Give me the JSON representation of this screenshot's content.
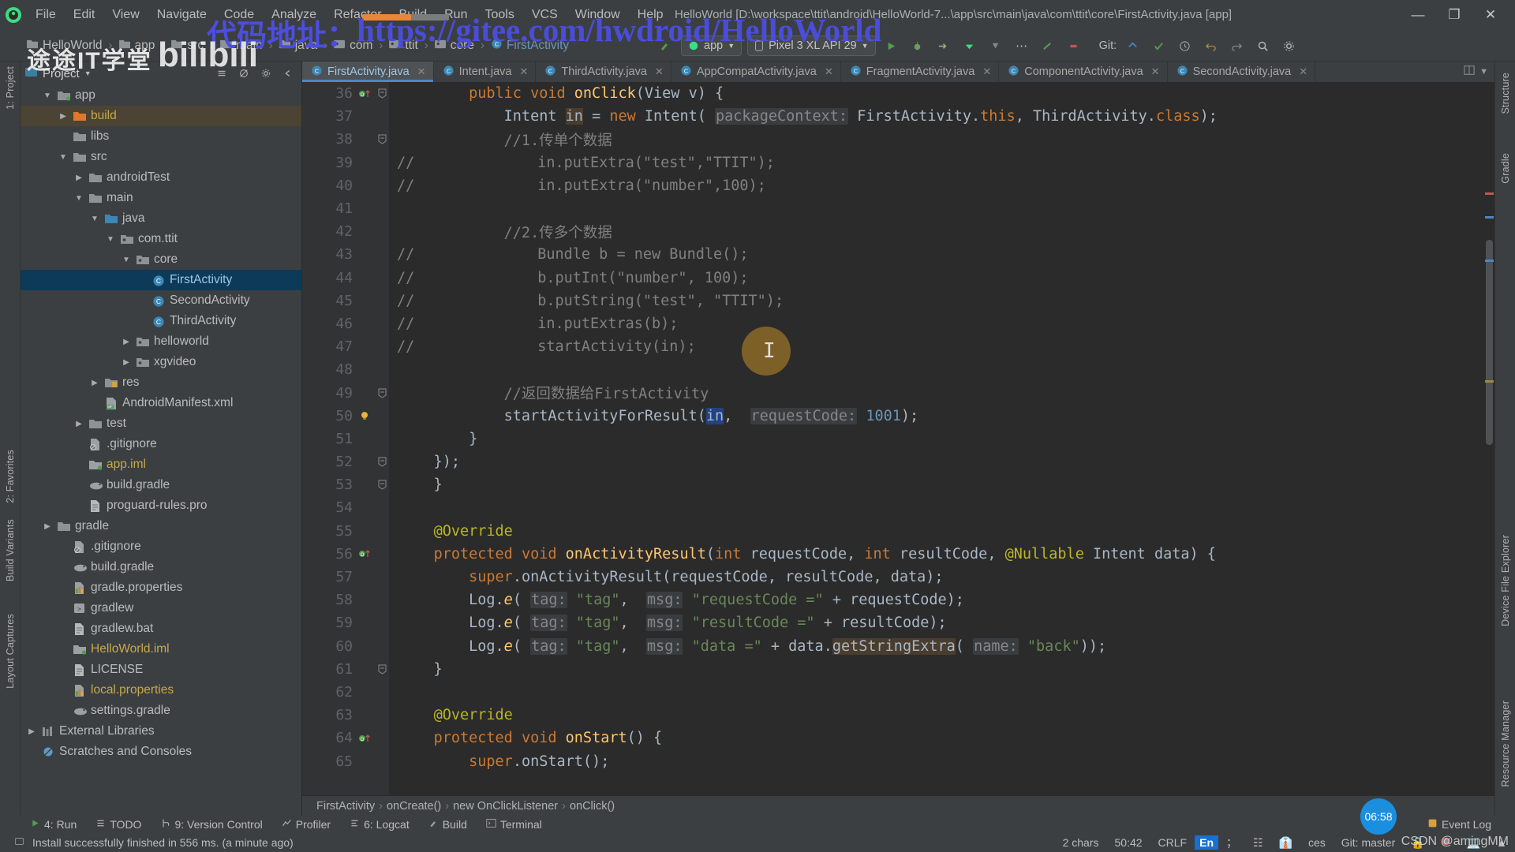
{
  "window": {
    "title": "HelloWorld [D:\\workspace\\ttit\\android\\HelloWorld-7...\\app\\src\\main\\java\\com\\ttit\\core\\FirstActivity.java [app]",
    "minimize": "—",
    "maximize": "❐",
    "close": "✕"
  },
  "menu": [
    {
      "label": "File"
    },
    {
      "label": "Edit"
    },
    {
      "label": "View"
    },
    {
      "label": "Navigate"
    },
    {
      "label": "Code"
    },
    {
      "label": "Analyze"
    },
    {
      "label": "Refactor"
    },
    {
      "label": "Build"
    },
    {
      "label": "Run"
    },
    {
      "label": "Tools"
    },
    {
      "label": "VCS"
    },
    {
      "label": "Window"
    },
    {
      "label": "Help"
    }
  ],
  "navbar": {
    "crumbs": [
      "HelloWorld",
      "app",
      "src",
      "main",
      "java",
      "com",
      "ttit",
      "core",
      "FirstActivity"
    ],
    "separator": "›",
    "module_combo": "app",
    "device_combo": "Pixel 3 XL API 29",
    "git_label": "Git:"
  },
  "project_panel": {
    "title": "Project",
    "tree": [
      {
        "indent": 1,
        "twisty": "down",
        "icon": "folder-module",
        "label": "app",
        "state": "normal"
      },
      {
        "indent": 2,
        "twisty": "right",
        "icon": "folder-orange",
        "label": "build",
        "state": "highlight"
      },
      {
        "indent": 2,
        "twisty": "none",
        "icon": "folder",
        "label": "libs",
        "state": "normal"
      },
      {
        "indent": 2,
        "twisty": "down",
        "icon": "folder",
        "label": "src",
        "state": "normal"
      },
      {
        "indent": 3,
        "twisty": "right",
        "icon": "folder",
        "label": "androidTest",
        "state": "normal"
      },
      {
        "indent": 3,
        "twisty": "down",
        "icon": "folder",
        "label": "main",
        "state": "normal"
      },
      {
        "indent": 4,
        "twisty": "down",
        "icon": "folder-blue",
        "label": "java",
        "state": "normal"
      },
      {
        "indent": 5,
        "twisty": "down",
        "icon": "package",
        "label": "com.ttit",
        "state": "normal"
      },
      {
        "indent": 6,
        "twisty": "down",
        "icon": "package",
        "label": "core",
        "state": "normal"
      },
      {
        "indent": 7,
        "twisty": "none",
        "icon": "class",
        "label": "FirstActivity",
        "state": "selected"
      },
      {
        "indent": 7,
        "twisty": "none",
        "icon": "class",
        "label": "SecondActivity",
        "state": "normal"
      },
      {
        "indent": 7,
        "twisty": "none",
        "icon": "class",
        "label": "ThirdActivity",
        "state": "normal"
      },
      {
        "indent": 6,
        "twisty": "right",
        "icon": "package",
        "label": "helloworld",
        "state": "normal"
      },
      {
        "indent": 6,
        "twisty": "right",
        "icon": "package",
        "label": "xgvideo",
        "state": "normal"
      },
      {
        "indent": 4,
        "twisty": "right",
        "icon": "folder-res",
        "label": "res",
        "state": "normal"
      },
      {
        "indent": 4,
        "twisty": "none",
        "icon": "manifest",
        "label": "AndroidManifest.xml",
        "state": "normal"
      },
      {
        "indent": 3,
        "twisty": "right",
        "icon": "folder",
        "label": "test",
        "state": "normal"
      },
      {
        "indent": 3,
        "twisty": "none",
        "icon": "gitignore",
        "label": ".gitignore",
        "state": "normal"
      },
      {
        "indent": 3,
        "twisty": "none",
        "icon": "iml",
        "label": "app.iml",
        "state": "yellow"
      },
      {
        "indent": 3,
        "twisty": "none",
        "icon": "gradle",
        "label": "build.gradle",
        "state": "normal"
      },
      {
        "indent": 3,
        "twisty": "none",
        "icon": "file",
        "label": "proguard-rules.pro",
        "state": "normal"
      },
      {
        "indent": 1,
        "twisty": "right",
        "icon": "folder",
        "label": "gradle",
        "state": "normal"
      },
      {
        "indent": 2,
        "twisty": "none",
        "icon": "gitignore",
        "label": ".gitignore",
        "state": "normal"
      },
      {
        "indent": 2,
        "twisty": "none",
        "icon": "gradle",
        "label": "build.gradle",
        "state": "normal"
      },
      {
        "indent": 2,
        "twisty": "none",
        "icon": "props",
        "label": "gradle.properties",
        "state": "normal"
      },
      {
        "indent": 2,
        "twisty": "none",
        "icon": "script",
        "label": "gradlew",
        "state": "normal"
      },
      {
        "indent": 2,
        "twisty": "none",
        "icon": "file",
        "label": "gradlew.bat",
        "state": "normal"
      },
      {
        "indent": 2,
        "twisty": "none",
        "icon": "iml",
        "label": "HelloWorld.iml",
        "state": "yellow"
      },
      {
        "indent": 2,
        "twisty": "none",
        "icon": "file",
        "label": "LICENSE",
        "state": "normal"
      },
      {
        "indent": 2,
        "twisty": "none",
        "icon": "props",
        "label": "local.properties",
        "state": "yellow"
      },
      {
        "indent": 2,
        "twisty": "none",
        "icon": "gradle",
        "label": "settings.gradle",
        "state": "normal"
      },
      {
        "indent": 0,
        "twisty": "right",
        "icon": "libs",
        "label": "External Libraries",
        "state": "normal"
      },
      {
        "indent": 0,
        "twisty": "none",
        "icon": "scratch",
        "label": "Scratches and Consoles",
        "state": "normal"
      }
    ]
  },
  "left_rail": [
    {
      "label": "1: Project"
    },
    {
      "label": "2: Favorites"
    },
    {
      "label": "Build Variants"
    },
    {
      "label": "Layout Captures"
    }
  ],
  "right_rail": [
    {
      "label": "Structure"
    },
    {
      "label": "Gradle"
    },
    {
      "label": "Device File Explorer"
    },
    {
      "label": "Resource Manager"
    }
  ],
  "editor_tabs": [
    {
      "label": "FirstActivity.java",
      "active": true,
      "close": "✕"
    },
    {
      "label": "Intent.java",
      "active": false,
      "close": "✕"
    },
    {
      "label": "ThirdActivity.java",
      "active": false,
      "close": "✕"
    },
    {
      "label": "AppCompatActivity.java",
      "active": false,
      "close": "✕"
    },
    {
      "label": "FragmentActivity.java",
      "active": false,
      "close": "✕"
    },
    {
      "label": "ComponentActivity.java",
      "active": false,
      "close": "✕"
    },
    {
      "label": "SecondActivity.java",
      "active": false,
      "close": "✕"
    }
  ],
  "code": {
    "first_line": 36,
    "lines": [
      {
        "n": 36,
        "gutter": "override-up",
        "fold": "open",
        "html": "        <span class='kw'>public</span> <span class='kw'>void</span> <span class='fn'>onClick</span>(<span class='cls'>View</span> v) {"
      },
      {
        "n": 37,
        "gutter": "",
        "fold": "",
        "html": "            <span class='cls'>Intent</span> <span class='hl2'>in</span> = <span class='kw'>new</span> <span class='cls'>Intent</span>( <span class='hint'>packageContext:</span> <span class='cls'>FirstActivity</span>.<span class='kw'>this</span>, <span class='cls'>ThirdActivity</span>.<span class='kw'>class</span>);"
      },
      {
        "n": 38,
        "gutter": "",
        "fold": "close",
        "html": "            <span class='cm'>//1.传单个数据</span>"
      },
      {
        "n": 39,
        "gutter": "",
        "fold": "",
        "comment_prefix": "//",
        "html": "              <span class='cm'>in.putExtra(\"test\",\"TTIT\");</span>"
      },
      {
        "n": 40,
        "gutter": "",
        "fold": "",
        "comment_prefix": "//",
        "html": "              <span class='cm'>in.putExtra(\"number\",100);</span>"
      },
      {
        "n": 41,
        "gutter": "",
        "fold": "",
        "html": ""
      },
      {
        "n": 42,
        "gutter": "",
        "fold": "",
        "html": "            <span class='cm'>//2.传多个数据</span>"
      },
      {
        "n": 43,
        "gutter": "",
        "fold": "",
        "comment_prefix": "//",
        "html": "              <span class='cm'>Bundle b = new Bundle();</span>"
      },
      {
        "n": 44,
        "gutter": "",
        "fold": "",
        "comment_prefix": "//",
        "html": "              <span class='cm'>b.putInt(\"number\", 100);</span>"
      },
      {
        "n": 45,
        "gutter": "",
        "fold": "",
        "comment_prefix": "//",
        "html": "              <span class='cm'>b.putString(\"test\", \"TTIT\");</span>"
      },
      {
        "n": 46,
        "gutter": "",
        "fold": "",
        "comment_prefix": "//",
        "html": "              <span class='cm'>in.putExtras(b);</span>"
      },
      {
        "n": 47,
        "gutter": "",
        "fold": "",
        "comment_prefix": "//",
        "html": "              <span class='cm'>startActivity(in);</span>"
      },
      {
        "n": 48,
        "gutter": "",
        "fold": "",
        "html": ""
      },
      {
        "n": 49,
        "gutter": "",
        "fold": "close",
        "html": "            <span class='cm'>//返回数据给FirstActivity</span>"
      },
      {
        "n": 50,
        "gutter": "bulb",
        "fold": "",
        "html": "            startActivityForResult(<span class='sel2'>in</span>,  <span class='hint'>requestCode:</span> <span class='num2'>1001</span>);"
      },
      {
        "n": 51,
        "gutter": "",
        "fold": "",
        "html": "        }"
      },
      {
        "n": 52,
        "gutter": "",
        "fold": "close",
        "html": "    });"
      },
      {
        "n": 53,
        "gutter": "",
        "fold": "close",
        "html": "    }"
      },
      {
        "n": 54,
        "gutter": "",
        "fold": "",
        "html": ""
      },
      {
        "n": 55,
        "gutter": "",
        "fold": "",
        "html": "    <span class='ann'>@Override</span>"
      },
      {
        "n": 56,
        "gutter": "override-up",
        "fold": "",
        "html": "    <span class='kw'>protected</span> <span class='kw'>void</span> <span class='fn'>onActivityResult</span>(<span class='kw'>int</span> requestCode, <span class='kw'>int</span> resultCode, <span class='ann'>@Nullable</span> <span class='cls'>Intent</span> data) {"
      },
      {
        "n": 57,
        "gutter": "",
        "fold": "",
        "html": "        <span class='kw'>super</span>.onActivityResult(requestCode, resultCode, data);"
      },
      {
        "n": 58,
        "gutter": "",
        "fold": "",
        "html": "        <span class='cls'>Log</span>.<span class='fn' style='font-style:italic'>e</span>( <span class='hint'>tag:</span> <span class='str'>\"tag\"</span>,  <span class='hint'>msg:</span> <span class='str'>\"requestCode =\"</span> + requestCode);"
      },
      {
        "n": 59,
        "gutter": "",
        "fold": "",
        "html": "        <span class='cls'>Log</span>.<span class='fn' style='font-style:italic'>e</span>( <span class='hint'>tag:</span> <span class='str'>\"tag\"</span>,  <span class='hint'>msg:</span> <span class='str'>\"resultCode =\"</span> + resultCode);"
      },
      {
        "n": 60,
        "gutter": "",
        "fold": "",
        "html": "        <span class='cls'>Log</span>.<span class='fn' style='font-style:italic'>e</span>( <span class='hint'>tag:</span> <span class='str'>\"tag\"</span>,  <span class='hint'>msg:</span> <span class='str'>\"data =\"</span> + data.<span class='hl2'>getStringExtra</span>( <span class='hint'>name:</span> <span class='str'>\"back\"</span>));"
      },
      {
        "n": 61,
        "gutter": "",
        "fold": "close",
        "html": "    }"
      },
      {
        "n": 62,
        "gutter": "",
        "fold": "",
        "html": ""
      },
      {
        "n": 63,
        "gutter": "",
        "fold": "",
        "html": "    <span class='ann'>@Override</span>"
      },
      {
        "n": 64,
        "gutter": "override-up",
        "fold": "",
        "html": "    <span class='kw'>protected</span> <span class='kw'>void</span> <span class='fn'>onStart</span>() {"
      },
      {
        "n": 65,
        "gutter": "",
        "fold": "",
        "html": "        <span class='kw'>super</span>.onStart();"
      }
    ]
  },
  "editor_breadcrumb": {
    "items": [
      "FirstActivity",
      "onCreate()",
      "new OnClickListener",
      "onClick()"
    ],
    "separator": "›"
  },
  "bottom_tools": [
    {
      "label": "4: Run",
      "icon": "run-icon"
    },
    {
      "label": "TODO",
      "icon": "todo-icon"
    },
    {
      "label": "9: Version Control",
      "icon": "vcs-icon"
    },
    {
      "label": "Profiler",
      "icon": "profiler-icon"
    },
    {
      "label": "6: Logcat",
      "icon": "logcat-icon"
    },
    {
      "label": "Build",
      "icon": "build-icon"
    },
    {
      "label": "Terminal",
      "icon": "terminal-icon"
    }
  ],
  "event_log": {
    "label": "Event Log"
  },
  "status_bar": {
    "message": "Install successfully finished in 556 ms. (a minute ago)",
    "chars": "2 chars",
    "caret_position": "50:42",
    "line_separator": "CRLF",
    "ime": "En",
    "encoding": "ces",
    "git_branch": "Git: master",
    "clock": "06:58"
  },
  "watermarks": {
    "url_cn": "代码地址：",
    "url": "https://gitee.com/hwdroid/HelloWorld",
    "brand_cn": "途途IT学堂",
    "brand_bili": "bilibili",
    "csdn": "CSDN @amingMM"
  }
}
